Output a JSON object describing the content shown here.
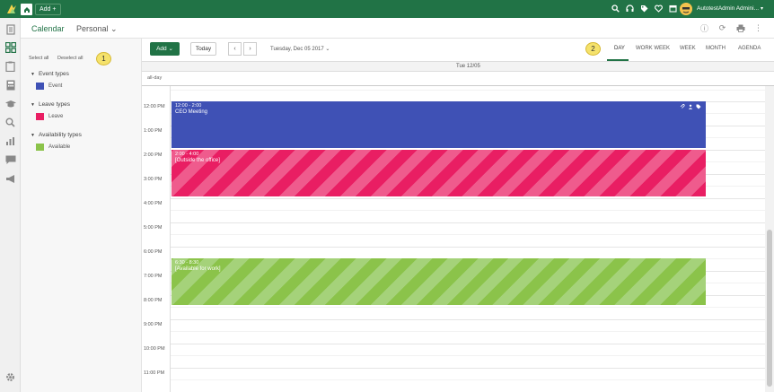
{
  "topbar": {
    "add_label": "Add +",
    "user_name": "AutotestAdmin Admini...",
    "icons": [
      "search-icon",
      "headset-icon",
      "tag-icon",
      "heart-icon",
      "calendar-icon"
    ],
    "brand_color": "#217346"
  },
  "header": {
    "title": "Calendar",
    "personal": "Personal ⌄"
  },
  "filters": {
    "select_all": "Select all",
    "deselect_all": "Deselect all",
    "badge_1": "1",
    "groups": [
      {
        "label": "Event types",
        "items": [
          {
            "label": "Event",
            "color": "#3f51b5"
          }
        ]
      },
      {
        "label": "Leave types",
        "items": [
          {
            "label": "Leave",
            "color": "#e91e63"
          }
        ]
      },
      {
        "label": "Availability types",
        "items": [
          {
            "label": "Available",
            "color": "#8bc34a"
          }
        ]
      }
    ]
  },
  "toolbar": {
    "add_label": "Add ⌄",
    "today_label": "Today",
    "prev": "‹",
    "next": "›",
    "date_label": "Tuesday, Dec 05 2017 ⌄",
    "badge_2": "2",
    "views": [
      "DAY",
      "WORK WEEK",
      "WEEK",
      "MONTH",
      "AGENDA"
    ],
    "active_view": "DAY"
  },
  "day_header": "Tue 12/05",
  "allday_label": "all-day",
  "hours": [
    "12:00 PM",
    "1:00 PM",
    "2:00 PM",
    "3:00 PM",
    "4:00 PM",
    "5:00 PM",
    "6:00 PM",
    "7:00 PM",
    "8:00 PM",
    "9:00 PM",
    "10:00 PM",
    "11:00 PM"
  ],
  "events": [
    {
      "time": "12:00 - 2:00",
      "title": "CEO Meeting",
      "type": "Event"
    },
    {
      "time": "2:00 - 4:00",
      "title": "[Outside the office]",
      "type": "Leave"
    },
    {
      "time": "6:30 - 8:30",
      "title": "[Available for work]",
      "type": "Available"
    }
  ]
}
